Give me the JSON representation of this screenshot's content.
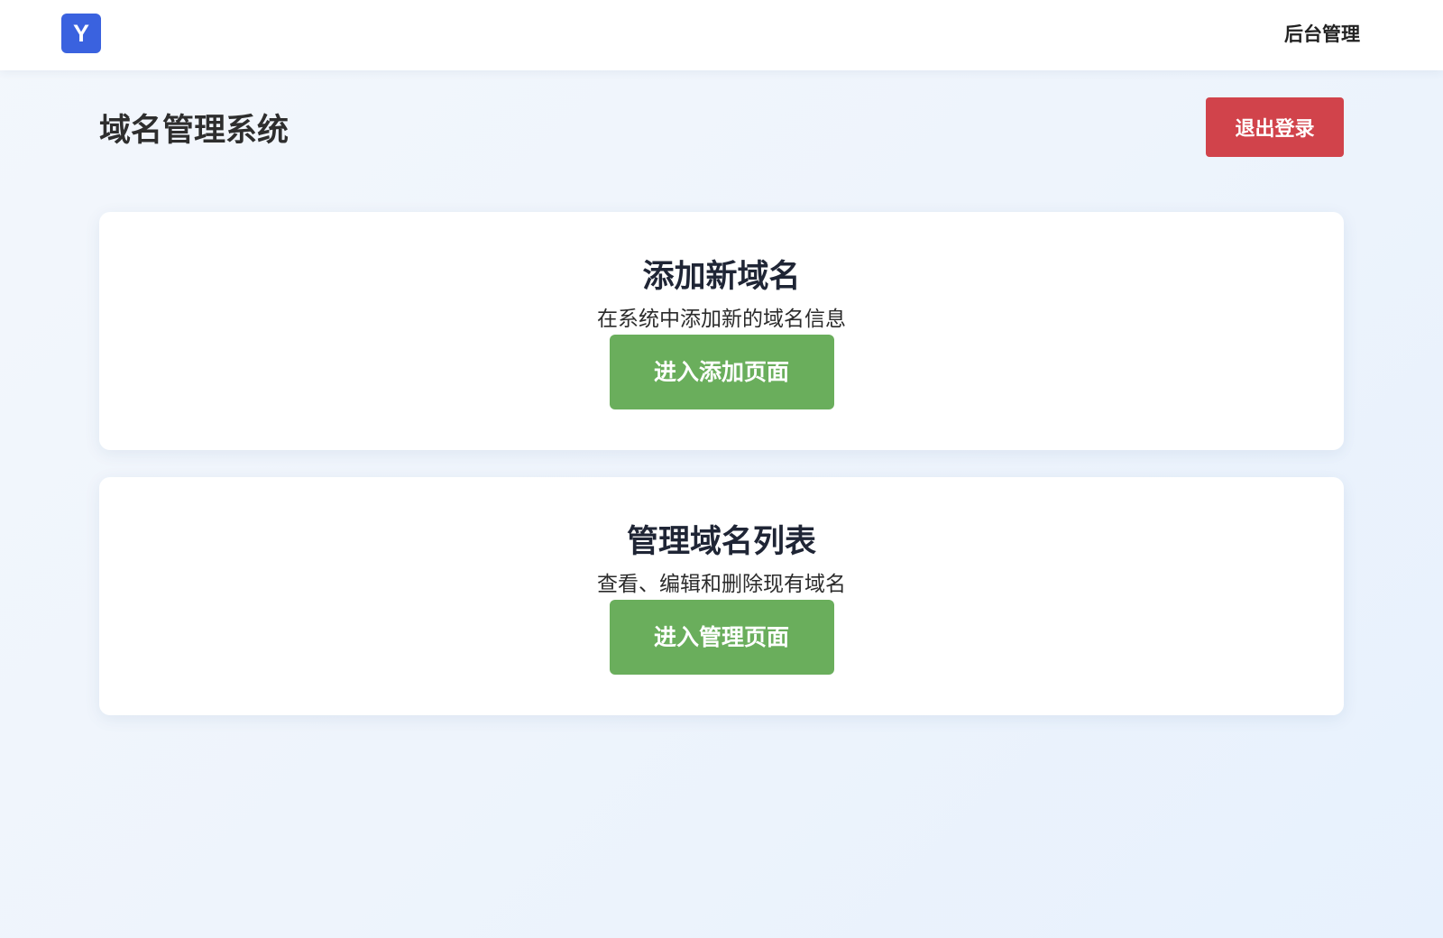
{
  "navbar": {
    "logo_letter": "Y",
    "admin_link": "后台管理"
  },
  "header": {
    "title": "域名管理系统",
    "logout_label": "退出登录"
  },
  "cards": [
    {
      "title": "添加新域名",
      "description": "在系统中添加新的域名信息",
      "button_label": "进入添加页面"
    },
    {
      "title": "管理域名列表",
      "description": "查看、编辑和删除现有域名",
      "button_label": "进入管理页面"
    }
  ],
  "colors": {
    "brand": "#3a62df",
    "danger": "#d1434b",
    "success": "#6aae5c",
    "bg_start": "#f3f7fc",
    "bg_end": "#e7f1fd"
  }
}
